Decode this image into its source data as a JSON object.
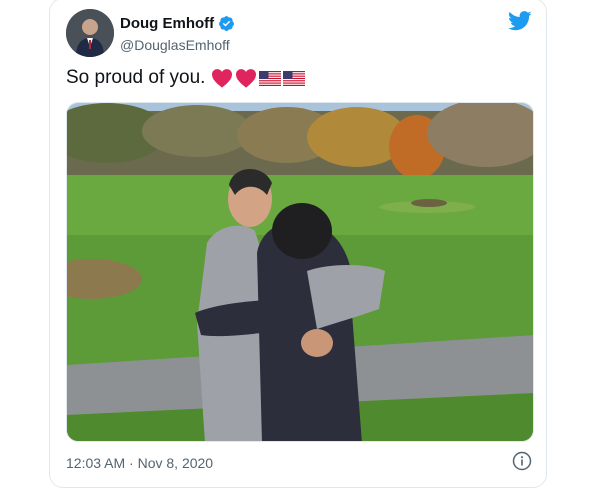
{
  "author": {
    "display_name": "Doug Emhoff",
    "handle": "@DouglasEmhoff",
    "verified": true
  },
  "tweet": {
    "text": "So proud of you.",
    "emoji": [
      "red-heart",
      "red-heart",
      "us-flag",
      "us-flag"
    ],
    "timestamp": "12:03 AM · Nov 8, 2020"
  },
  "icons": {
    "brand": "twitter-bird-icon",
    "info": "info-icon",
    "verified": "verified-badge-icon"
  },
  "colors": {
    "brand_blue": "#1d9bf0",
    "text_primary": "#0f1419",
    "text_secondary": "#536471",
    "heart_red": "#e0245e"
  }
}
